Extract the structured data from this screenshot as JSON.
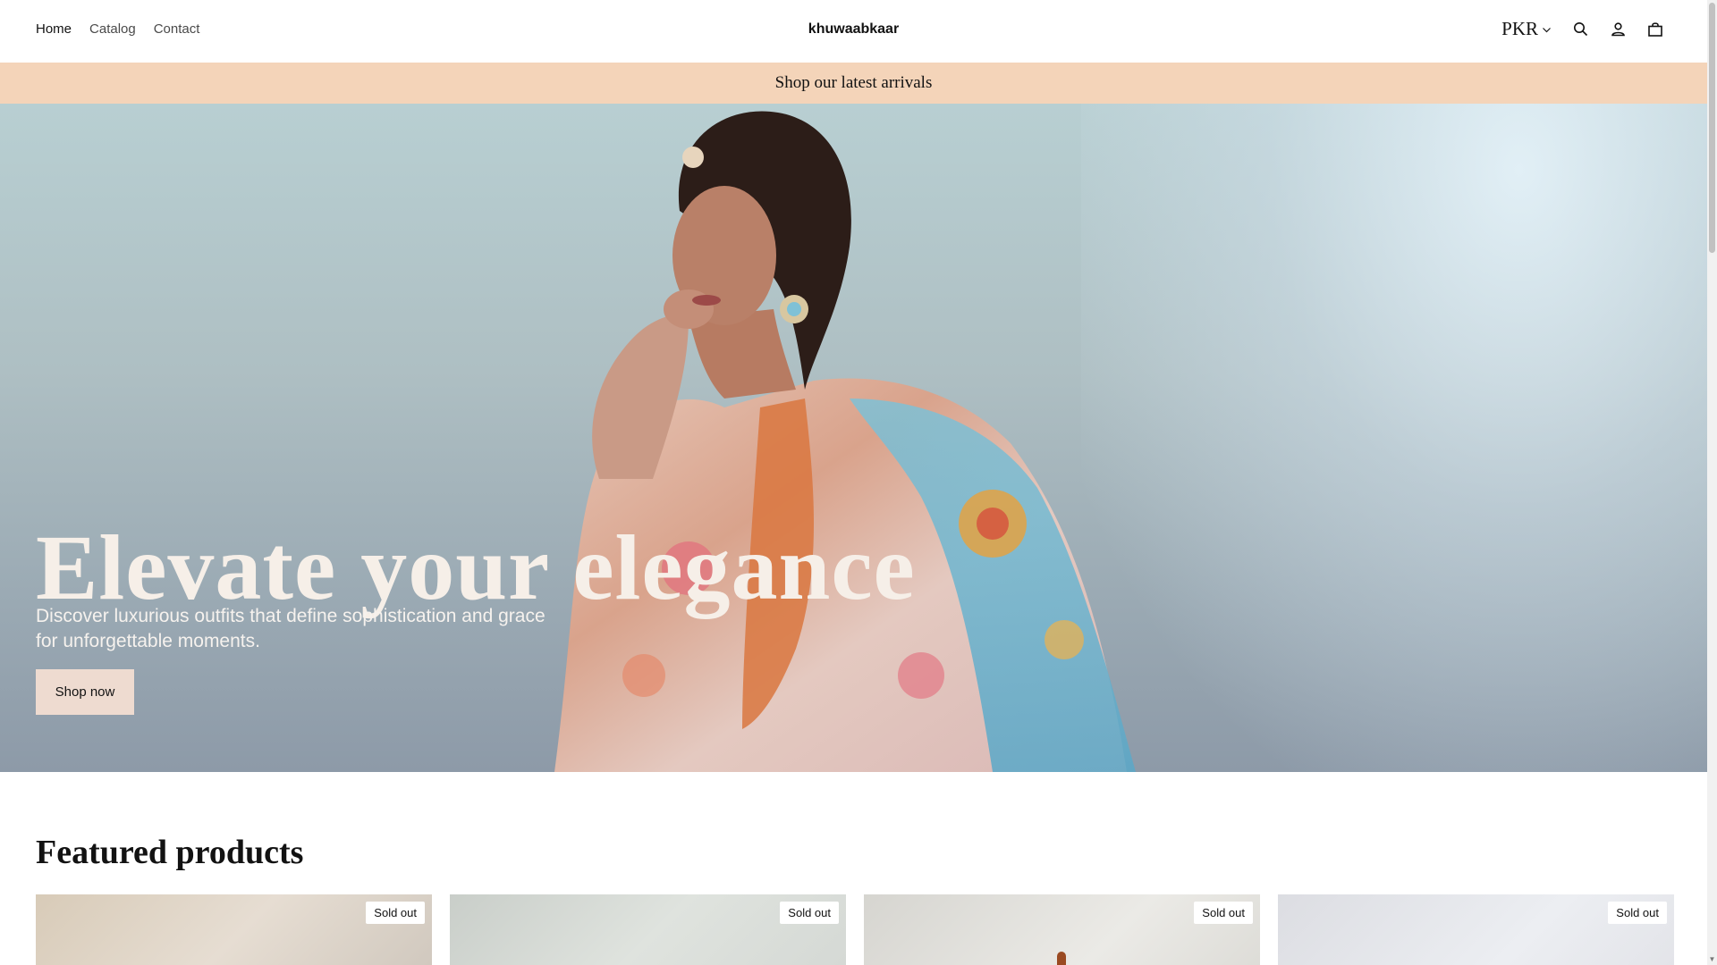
{
  "header": {
    "nav": [
      {
        "label": "Home",
        "active": true
      },
      {
        "label": "Catalog",
        "active": false
      },
      {
        "label": "Contact",
        "active": false
      }
    ],
    "logo": "khuwaabkaar",
    "currency": "PKR",
    "icons": [
      "search-icon",
      "account-icon",
      "cart-icon"
    ]
  },
  "announcement": {
    "text": "Shop our latest arrivals"
  },
  "hero": {
    "heading": "Elevate your elegance",
    "subtext": "Discover luxurious outfits that define sophistication and grace for unforgettable moments.",
    "button_label": "Shop now"
  },
  "featured": {
    "title": "Featured products",
    "products": [
      {
        "badge": "Sold out"
      },
      {
        "badge": "Sold out"
      },
      {
        "badge": "Sold out"
      },
      {
        "badge": "Sold out"
      }
    ]
  },
  "colors": {
    "announcement_bg": "#f4d4b9",
    "button_bg": "#eedbd0",
    "hero_text": "#f6efe8"
  }
}
